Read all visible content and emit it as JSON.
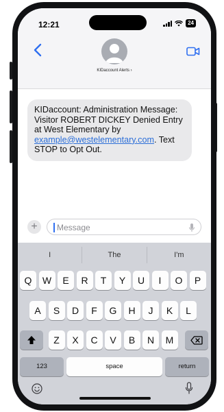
{
  "status_bar": {
    "time": "12:21",
    "battery": "24"
  },
  "header": {
    "contact_name": "KIDaccount Alerts ›"
  },
  "message": {
    "text_before_link": "KIDaccount: Administration Message: Visitor ROBERT DICKEY Denied Entry at West Elementary by ",
    "link": "example@westelementary.com",
    "text_after_link": ". Text STOP to Opt Out."
  },
  "compose": {
    "placeholder": "Message",
    "plus_label": "+"
  },
  "keyboard": {
    "predictions": [
      "I",
      "The",
      "I'm"
    ],
    "row1": [
      "Q",
      "W",
      "E",
      "R",
      "T",
      "Y",
      "U",
      "I",
      "O",
      "P"
    ],
    "row2": [
      "A",
      "S",
      "D",
      "F",
      "G",
      "H",
      "J",
      "K",
      "L"
    ],
    "row3": [
      "Z",
      "X",
      "C",
      "V",
      "B",
      "N",
      "M"
    ],
    "numbers_label": "123",
    "space_label": "space",
    "return_label": "return"
  },
  "colors": {
    "accent": "#2f6ff0",
    "bubble": "#e9e9eb",
    "keyboard_bg": "#d1d3d9"
  }
}
